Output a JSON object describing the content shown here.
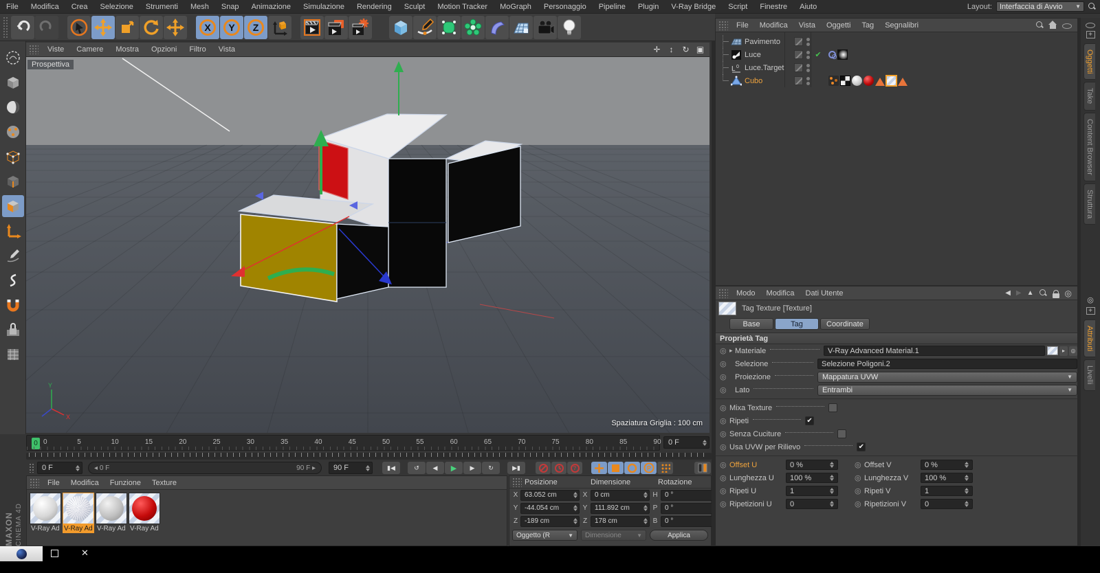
{
  "menubar": {
    "items": [
      "File",
      "Modifica",
      "Crea",
      "Selezione",
      "Strumenti",
      "Mesh",
      "Snap",
      "Animazione",
      "Simulazione",
      "Rendering",
      "Sculpt",
      "Motion Tracker",
      "MoGraph",
      "Personaggio",
      "Pipeline",
      "Plugin",
      "V-Ray Bridge",
      "Script",
      "Finestre",
      "Aiuto"
    ],
    "layout_label": "Layout:",
    "layout_value": "Interfaccia di Avvio"
  },
  "toolbar": {
    "axis_buttons": [
      "X",
      "Y",
      "Z"
    ]
  },
  "viewport": {
    "menu": [
      "Viste",
      "Camere",
      "Mostra",
      "Opzioni",
      "Filtro",
      "Vista"
    ],
    "view_label": "Prospettiva",
    "grid_spacing_label": "Spaziatura Griglia : 100 cm",
    "axis_labels": {
      "x": "X",
      "y": "Y"
    }
  },
  "timeline": {
    "tick_labels": [
      "0",
      "5",
      "10",
      "15",
      "20",
      "25",
      "30",
      "35",
      "40",
      "45",
      "50",
      "55",
      "60",
      "65",
      "70",
      "75",
      "80",
      "85",
      "90"
    ],
    "playhead_label": "0",
    "frame_field": "0 F"
  },
  "transport": {
    "current_frame": "0 F",
    "range_start": "0 F",
    "range_end": "90 F",
    "end_frame": "90 F"
  },
  "materials_panel": {
    "menu": [
      "File",
      "Modifica",
      "Funzione",
      "Texture"
    ],
    "items": [
      {
        "label": "V-Ray Ad",
        "type": "white",
        "selected": false
      },
      {
        "label": "V-Ray Ad",
        "type": "sketch",
        "selected": true
      },
      {
        "label": "V-Ray Ad",
        "type": "gray",
        "selected": false
      },
      {
        "label": "V-Ray Ad",
        "type": "red",
        "selected": false
      }
    ]
  },
  "coordinates_panel": {
    "headers": [
      "Posizione",
      "Dimensione",
      "Rotazione"
    ],
    "position": {
      "x_label": "X",
      "x": "63.052 cm",
      "y_label": "Y",
      "y": "-44.054 cm",
      "z_label": "Z",
      "z": "-189 cm"
    },
    "dimension": {
      "x_label": "X",
      "x": "0 cm",
      "y_label": "Y",
      "y": "111.892 cm",
      "z_label": "Z",
      "z": "178 cm"
    },
    "rotation": {
      "h_label": "H",
      "h": "0 °",
      "p_label": "P",
      "p": "0 °",
      "b_label": "B",
      "b": "0 °"
    },
    "object_dropdown": "Oggetto (R",
    "dimension_dropdown": "Dimensione",
    "apply_button": "Applica"
  },
  "object_manager": {
    "menu": [
      "File",
      "Modifica",
      "Vista",
      "Oggetti",
      "Tag",
      "Segnalibri"
    ],
    "objects": [
      {
        "name": "Pavimento",
        "icon": "floor",
        "selected": false,
        "checked": false,
        "tags": []
      },
      {
        "name": "Luce",
        "icon": "light",
        "selected": false,
        "checked": true,
        "tags": [
          "t-target",
          "t-lightprev"
        ]
      },
      {
        "name": "Luce.Target",
        "icon": "target",
        "selected": false,
        "checked": false,
        "tags": []
      },
      {
        "name": "Cubo",
        "icon": "polygon",
        "selected": true,
        "checked": false,
        "tags": [
          "t-points",
          "t-polysel",
          "t-matwhite",
          "t-matred",
          "t-tri",
          "t-texsel",
          "t-tri"
        ]
      }
    ]
  },
  "attribute_manager": {
    "menu": [
      "Modo",
      "Modifica",
      "Dati Utente"
    ],
    "title": "Tag Texture [Texture]",
    "tabs": [
      {
        "label": "Base",
        "active": false
      },
      {
        "label": "Tag",
        "active": true
      },
      {
        "label": "Coordinate",
        "active": false
      }
    ],
    "section_title": "Proprietà Tag",
    "rows": [
      {
        "label": "Materiale",
        "value": "V-Ray Advanced Material.1",
        "type": "textfield-thumb",
        "expand": true
      },
      {
        "label": "Selezione",
        "value": "Selezione Poligoni.2",
        "type": "textfield",
        "expand": false
      },
      {
        "label": "Proiezione",
        "value": "Mappatura UVW",
        "type": "dropdown",
        "expand": false
      },
      {
        "label": "Lato",
        "value": "Entrambi",
        "type": "dropdown",
        "expand": false
      }
    ],
    "checkboxes": [
      {
        "label": "Mixa Texture",
        "checked": false
      },
      {
        "label": "Ripeti",
        "checked": true
      },
      {
        "label": "Senza Cuciture",
        "checked": false
      },
      {
        "label": "Usa UVW per Rilievo",
        "checked": true
      }
    ],
    "uv_fields": [
      {
        "label": "Offset U",
        "value": "0 %",
        "highlight": true
      },
      {
        "label": "Offset V",
        "value": "0 %",
        "highlight": false
      },
      {
        "label": "Lunghezza U",
        "value": "100 %",
        "highlight": false
      },
      {
        "label": "Lunghezza V",
        "value": "100 %",
        "highlight": false
      },
      {
        "label": "Ripeti U",
        "value": "1",
        "highlight": false
      },
      {
        "label": "Ripeti V",
        "value": "1",
        "highlight": false
      },
      {
        "label": "Ripetizioni U",
        "value": "0",
        "highlight": false
      },
      {
        "label": "Ripetizioni V",
        "value": "0",
        "highlight": false
      }
    ]
  },
  "right_tabs": {
    "top": [
      {
        "label": "Oggetti",
        "active": true
      },
      {
        "label": "Take",
        "active": false
      },
      {
        "label": "Content Browser",
        "active": false
      },
      {
        "label": "Struttura",
        "active": false
      }
    ],
    "bottom": [
      {
        "label": "Attributi",
        "active": true
      },
      {
        "label": "Livelli",
        "active": false
      }
    ]
  },
  "branding": {
    "line1": "MAXON",
    "line2": "CINEMA 4D"
  },
  "colors": {
    "accent_orange": "#f29b2c",
    "highlight_blue": "#7d9cc8",
    "timeline_green": "#3fc06a",
    "record_red": "#c23a3a"
  }
}
